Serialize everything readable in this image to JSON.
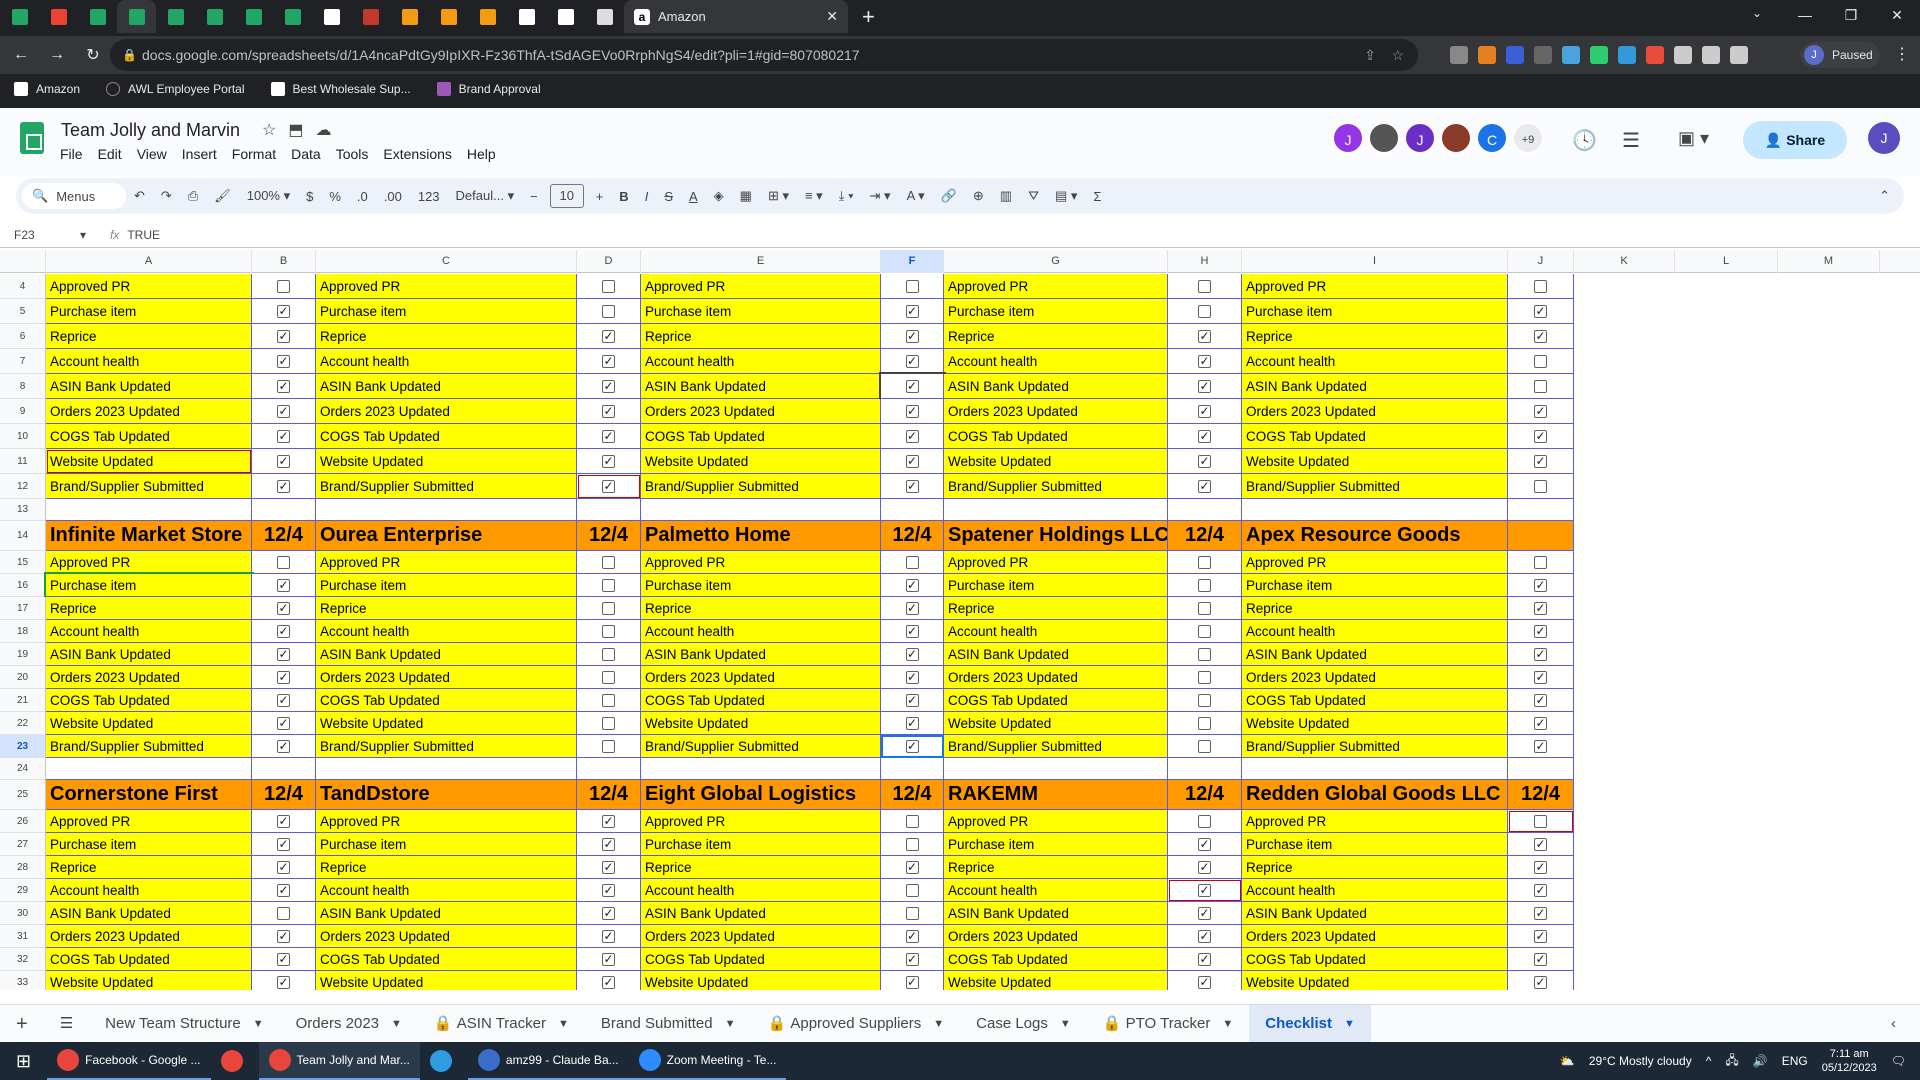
{
  "browser": {
    "active_tab_title": "Amazon",
    "url": "docs.google.com/spreadsheets/d/1A4ncaPdtGy9IpIXR-Fz36ThfA-tSdAGEVo0RrphNgS4/edit?pli=1#gid=807080217",
    "profile_label": "Paused",
    "profile_initial": "J",
    "bookmarks": [
      "Amazon",
      "AWL Employee Portal",
      "Best Wholesale Sup...",
      "Brand Approval"
    ]
  },
  "doc": {
    "title": "Team Jolly and Marvin",
    "menus": [
      "File",
      "Edit",
      "View",
      "Insert",
      "Format",
      "Data",
      "Tools",
      "Extensions",
      "Help"
    ],
    "share_label": "Share",
    "collaborators": [
      "J",
      "",
      "J",
      "",
      "C",
      "+9"
    ],
    "user_initial": "J"
  },
  "toolbar": {
    "menus_search": "Menus",
    "zoom": "100%",
    "currency": "$",
    "percent": "%",
    "dec_dec": ".0",
    "inc_dec": ".00",
    "num_fmt": "123",
    "font": "Defaul...",
    "font_size": "10"
  },
  "formula_bar": {
    "cell_ref": "F23",
    "value": "TRUE"
  },
  "columns": [
    "A",
    "B",
    "C",
    "D",
    "E",
    "F",
    "G",
    "H",
    "I",
    "J",
    "K",
    "L",
    "M"
  ],
  "blocks": [
    {
      "header_row": 3,
      "hidden_header": true,
      "groups": [
        {
          "name": "",
          "date": "",
          "checks": [
            false,
            true,
            true,
            true,
            true,
            true,
            true,
            true,
            true
          ]
        },
        {
          "name": "",
          "date": "",
          "checks": [
            false,
            false,
            true,
            true,
            true,
            true,
            true,
            true,
            true
          ]
        },
        {
          "name": "",
          "date": "",
          "checks": [
            false,
            true,
            true,
            true,
            true,
            true,
            true,
            true,
            true
          ]
        },
        {
          "name": "",
          "date": "",
          "checks": [
            false,
            false,
            true,
            true,
            true,
            true,
            true,
            true,
            true
          ]
        },
        {
          "name": "",
          "date": "",
          "checks": [
            false,
            true,
            true,
            false,
            false,
            true,
            true,
            true,
            false
          ]
        }
      ]
    },
    {
      "header_row": 14,
      "groups": [
        {
          "name": "Infinite Market Store",
          "date": "12/4",
          "checks": [
            false,
            true,
            true,
            true,
            true,
            true,
            true,
            true,
            true
          ]
        },
        {
          "name": "Ourea Enterprise",
          "date": "12/4",
          "checks": [
            false,
            false,
            false,
            false,
            false,
            false,
            false,
            false,
            false
          ]
        },
        {
          "name": "Palmetto Home",
          "date": "12/4",
          "checks": [
            false,
            true,
            true,
            true,
            true,
            true,
            true,
            true,
            true
          ]
        },
        {
          "name": "Spatener Holdings LLC",
          "date": "12/4",
          "checks": [
            false,
            false,
            false,
            false,
            false,
            false,
            false,
            false,
            false
          ]
        },
        {
          "name": "Apex Resource Goods",
          "date": "",
          "checks": [
            false,
            true,
            true,
            true,
            true,
            true,
            true,
            true,
            true
          ]
        }
      ]
    },
    {
      "header_row": 25,
      "groups": [
        {
          "name": "Cornerstone First",
          "date": "12/4",
          "checks": [
            true,
            true,
            true,
            true,
            false,
            true,
            true,
            true
          ]
        },
        {
          "name": "TandDstore",
          "date": "12/4",
          "checks": [
            true,
            true,
            true,
            true,
            true,
            true,
            true,
            true
          ]
        },
        {
          "name": "Eight Global Logistics",
          "date": "12/4",
          "checks": [
            false,
            false,
            true,
            false,
            false,
            true,
            true,
            true
          ]
        },
        {
          "name": "RAKEMM",
          "date": "12/4",
          "checks": [
            false,
            true,
            true,
            true,
            true,
            true,
            true,
            true
          ]
        },
        {
          "name": "Redden Global Goods LLC",
          "date": "12/4",
          "checks": [
            false,
            true,
            true,
            true,
            true,
            true,
            true,
            true
          ]
        }
      ]
    }
  ],
  "task_labels": [
    "Approved PR",
    "Purchase item",
    "Reprice",
    "Account health",
    "ASIN Bank Updated",
    "Orders 2023 Updated",
    "COGS Tab Updated",
    "Website Updated",
    "Brand/Supplier Submitted"
  ],
  "sheet_tabs": [
    "New Team Structure",
    "Orders 2023",
    "ASIN Tracker",
    "Brand Submitted",
    "Approved Suppliers",
    "Case Logs",
    "PTO Tracker",
    "Checklist"
  ],
  "active_sheet": "Checklist",
  "taskbar": {
    "items": [
      "Facebook - Google ...",
      "Team Jolly and Mar...",
      "amz99 - Claude Ba...",
      "Zoom Meeting - Te..."
    ],
    "weather": "29°C  Mostly cloudy",
    "lang": "ENG",
    "time": "7:11 am",
    "date": "05/12/2023"
  }
}
